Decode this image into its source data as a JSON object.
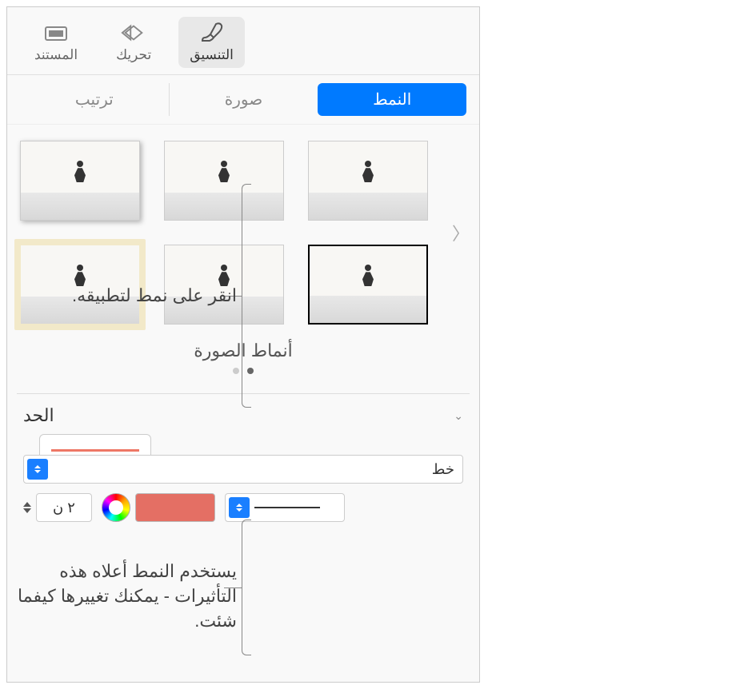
{
  "toolbar": {
    "format": "التنسيق",
    "animate": "تحريك",
    "document": "المستند"
  },
  "tabs": {
    "style": "النمط",
    "image": "صورة",
    "arrange": "ترتيب"
  },
  "styles": {
    "section_title": "أنماط الصورة"
  },
  "border": {
    "label": "الحد",
    "type_value": "خط",
    "width_value": "٢ ن"
  },
  "callouts": {
    "c1": "انقر على نمط لتطبيقه.",
    "c2": "يستخدم النمط أعلاه هذه التأثيرات - يمكنك تغييرها كيفما شئت."
  },
  "colors": {
    "accent": "#007aff",
    "border_color": "#e46f64"
  }
}
